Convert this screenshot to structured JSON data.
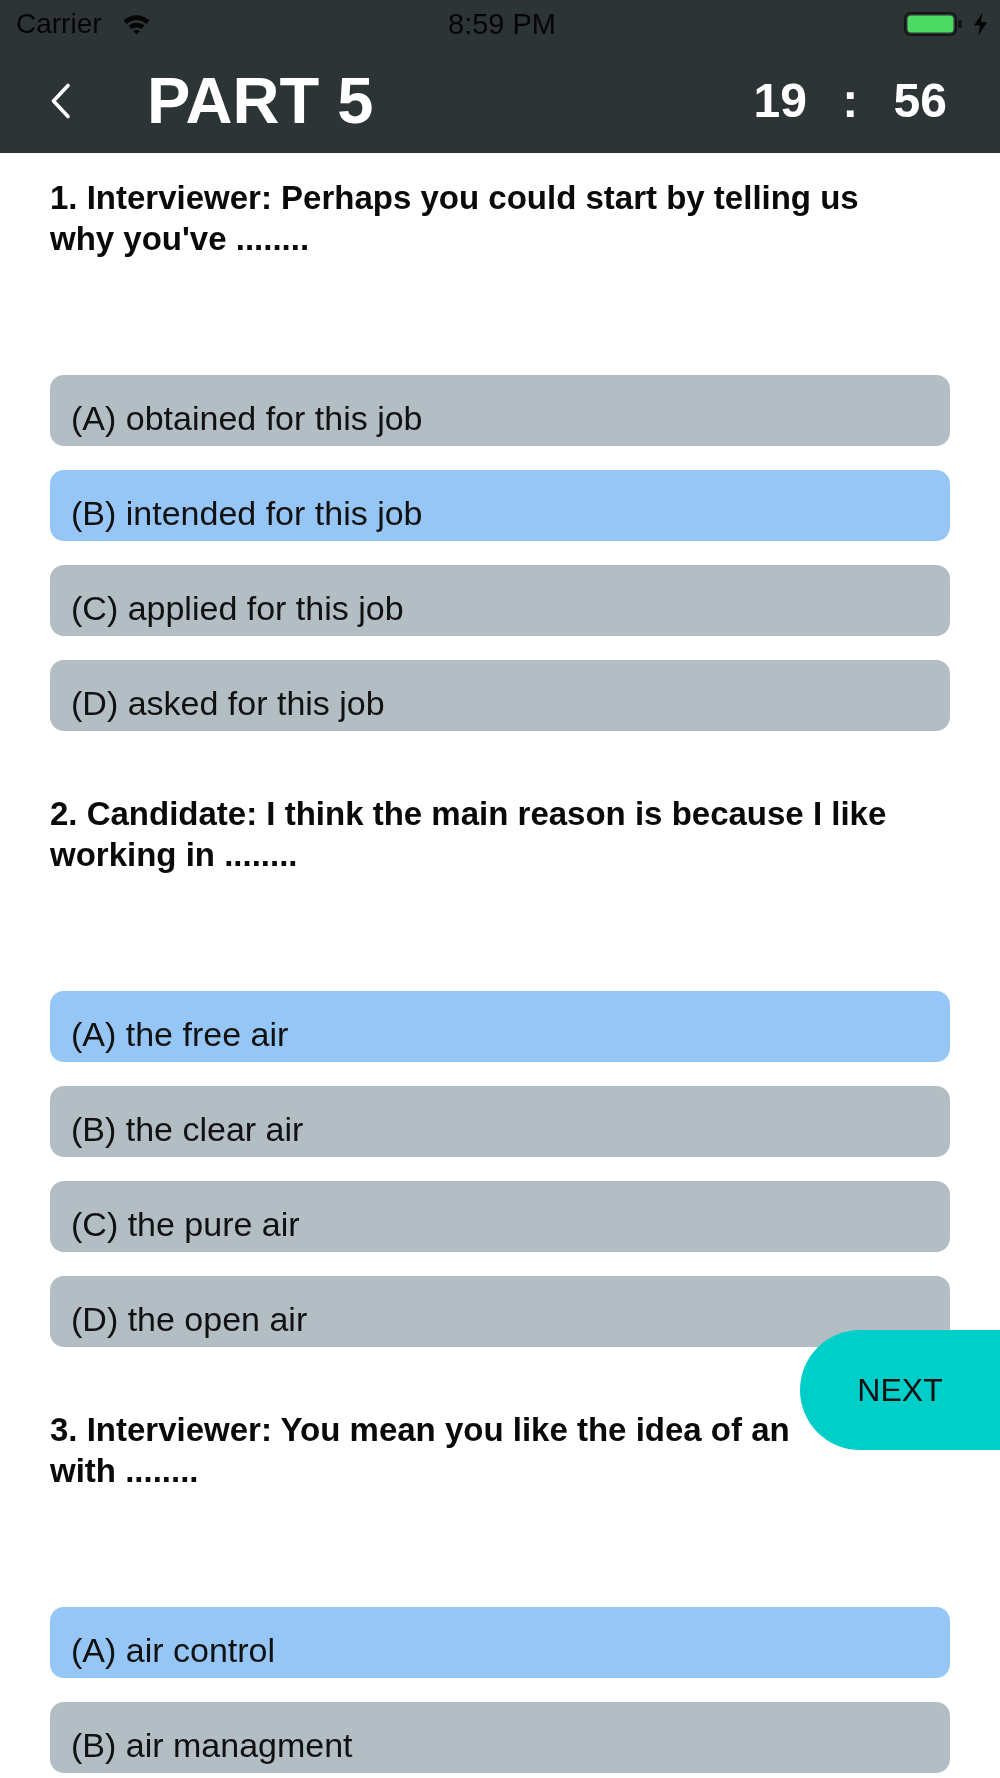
{
  "status_bar": {
    "carrier": "Carrier",
    "time": "8:59 PM",
    "battery": {
      "charging": true
    }
  },
  "header": {
    "title": "PART 5",
    "timer": "19 : 56"
  },
  "questions": [
    {
      "text": "1. Interviewer: Perhaps you could start by telling us why you've ........",
      "options": [
        {
          "label": "(A) obtained for this job",
          "selected": false
        },
        {
          "label": "(B) intended for this job",
          "selected": true
        },
        {
          "label": "(C) applied for this job",
          "selected": false
        },
        {
          "label": "(D) asked for this job",
          "selected": false
        }
      ]
    },
    {
      "text": "2. Candidate: I think the main reason is because I like working in ........",
      "options": [
        {
          "label": "(A) the free air",
          "selected": true
        },
        {
          "label": "(B) the clear air",
          "selected": false
        },
        {
          "label": "(C) the pure air",
          "selected": false
        },
        {
          "label": "(D) the open air",
          "selected": false
        }
      ]
    },
    {
      "text": "3. Interviewer: You mean you like the idea of an",
      "text_continued": "with ........",
      "options": [
        {
          "label": "(A) air control",
          "selected": true
        },
        {
          "label": "(B) air managment",
          "selected": false
        }
      ]
    }
  ],
  "next_button": {
    "label": "NEXT"
  }
}
